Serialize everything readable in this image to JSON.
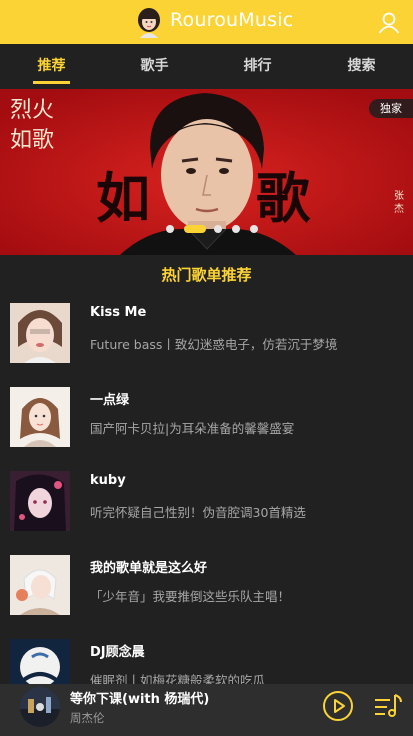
{
  "header": {
    "app_title": "RourouMusic"
  },
  "tabs": [
    {
      "label": "推荐",
      "active": true
    },
    {
      "label": "歌手",
      "active": false
    },
    {
      "label": "排行",
      "active": false
    },
    {
      "label": "搜索",
      "active": false
    }
  ],
  "banner": {
    "badge": "独家",
    "side_text": "烈火如歌",
    "title_text": "如歌",
    "singer_text": "张杰",
    "slide_count": 5,
    "active_slide": 1
  },
  "section_title": "热门歌单推荐",
  "playlists": [
    {
      "name": "Kiss Me",
      "desc": "Future bass丨致幻迷惑电子，仿若沉于梦境"
    },
    {
      "name": "一点绿",
      "desc": "国产阿卡贝拉|为耳朵准备的馨馨盛宴"
    },
    {
      "name": "kuby",
      "desc": "听完怀疑自己性别！伪音腔调30首精选"
    },
    {
      "name": "我的歌单就是这么好",
      "desc": "「少年音」我要推倒这些乐队主唱！"
    },
    {
      "name": "DJ顾念晨",
      "desc": "催眠剂丨如梅花糖般柔软的吃瓜"
    }
  ],
  "player": {
    "song": "等你下课(with 杨瑞代)",
    "artist": "周杰伦"
  },
  "colors": {
    "accent": "#fcd335",
    "background": "#212121",
    "banner_red": "#bf1216"
  }
}
